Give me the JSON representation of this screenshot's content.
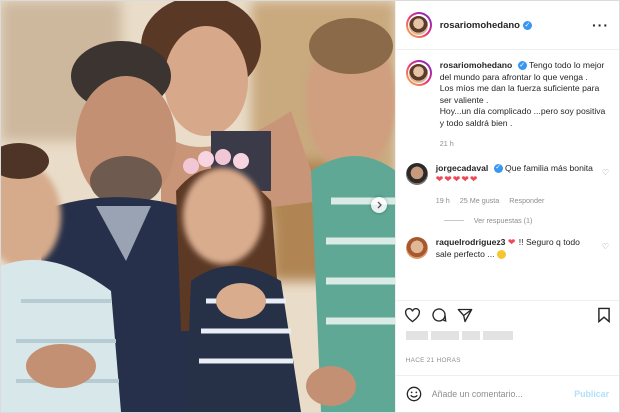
{
  "post": {
    "username": "rosariomohedano",
    "more_icon": "more-horizontal-icon"
  },
  "caption": {
    "username": "rosariomohedano",
    "text": "Tengo todo lo mejor del mundo para afrontar lo que venga .\nLos míos me dan la fuerza suficiente para ser valiente .\nHoy...un día complicado ...pero soy positiva y todo saldrá bien .",
    "time": "21 h"
  },
  "comments": [
    {
      "username": "jorgecadaval",
      "text": "Que familia más bonita",
      "hearts": "❤❤❤❤❤",
      "time": "19 h",
      "likes": "25 Me gusta",
      "reply": "Responder",
      "view_replies": "Ver respuestas (1)"
    },
    {
      "username": "raquelrodriguez3",
      "text": " !! Seguro q todo sale perfecto ...",
      "heart": "❤"
    }
  ],
  "post_time": "HACE 21 HORAS",
  "add_comment": {
    "placeholder": "Añade un comentario...",
    "publish": "Publicar"
  },
  "colors": {
    "accent": "#3897f0",
    "heart": "#ed4956",
    "muted": "#8e8e8e"
  }
}
